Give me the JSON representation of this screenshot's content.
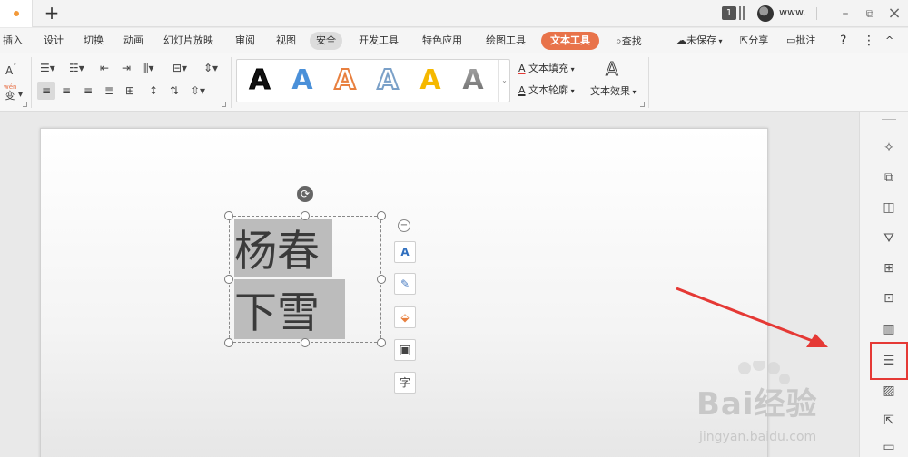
{
  "titlebar": {
    "new_tab": "+",
    "badge": "1",
    "user": "www.",
    "minimize": "–",
    "restore": "⧉",
    "close": "×"
  },
  "menu": {
    "items": [
      "插入",
      "设计",
      "切换",
      "动画",
      "幻灯片放映",
      "审阅",
      "视图",
      "安全",
      "开发工具",
      "特色应用",
      "绘图工具",
      "文本工具"
    ],
    "search": "查找",
    "unsaved": "未保存",
    "share": "分享",
    "comment": "批注",
    "help": "?",
    "more": "⋮",
    "collapse": "^"
  },
  "ribbon": {
    "font_size_icon": "A",
    "phonetic_top": "wén",
    "phonetic_bottom": "变",
    "wordart_letter": "A",
    "text_fill": "文本填充",
    "text_outline": "文本轮廓",
    "text_effect": "文本效果"
  },
  "slide": {
    "line1": "杨春",
    "line2": "下雪"
  },
  "float_toolbar": {
    "text_direction_label": "A",
    "char_label": "字"
  },
  "watermark": {
    "brand": "Bai经验",
    "url": "jingyan.baidu.com"
  },
  "colors": {
    "accent": "#e8734a",
    "highlight_box": "#e53935",
    "arrow": "#e53935",
    "wordart": [
      "#111111",
      "#4a90d9",
      "#e8803f",
      "#ffffff",
      "#f5b800",
      "#888888"
    ]
  }
}
